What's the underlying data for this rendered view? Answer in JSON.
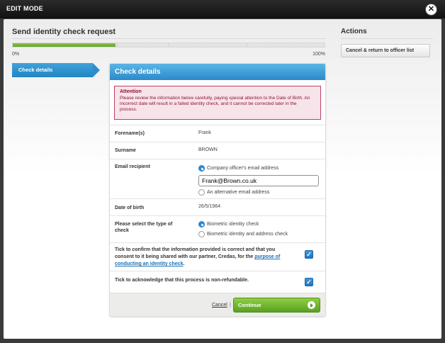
{
  "window": {
    "title": "EDIT MODE",
    "close_symbol": "✕"
  },
  "page": {
    "heading": "Send identity check request"
  },
  "progress": {
    "min_label": "0%",
    "max_label": "100%",
    "value_fraction": 0.33
  },
  "steps": [
    {
      "label": "Check details",
      "active": true
    }
  ],
  "card": {
    "title": "Check details",
    "attention": {
      "title": "Attention",
      "text": "Please review the information below carefully, paying special attention to the Date of Birth. An incorrect date will result in a failed identity check, and it cannot be corrected later in the process."
    },
    "fields": {
      "forename": {
        "label": "Forename(s)",
        "value": "Frank"
      },
      "surname": {
        "label": "Surname",
        "value": "BROWN"
      },
      "email": {
        "label": "Email recipient",
        "option_company": "Company officer's email address",
        "input_value": "Frank@Brown.co.uk",
        "option_alternative": "An alternative email address",
        "selected": "company"
      },
      "dob": {
        "label": "Date of birth",
        "value": "26/5/1964"
      },
      "check_type": {
        "label": "Please select the type of check",
        "option_biometric": "Biometric identity check",
        "option_biometric_address": "Biometric identity and address check",
        "selected": "biometric"
      }
    },
    "consent": {
      "text_before": "Tick to confirm that the information provided is correct and that you consent to it being shared with our partner, Credas, for the ",
      "link_text": "purpose of conducting an identity check",
      "text_after": ".",
      "checked": true
    },
    "nonrefundable": {
      "text": "Tick to acknowledge that this process is non-refundable.",
      "checked": true
    },
    "footer": {
      "cancel_label": "Cancel",
      "separator": "|",
      "continue_label": "Continue"
    }
  },
  "actions": {
    "title": "Actions",
    "button_label": "Cancel & return to officer list"
  },
  "colors": {
    "accent_blue": "#2d8ac9",
    "continue_green": "#5aa021",
    "progress_green": "#62a12b",
    "attention_red": "#c14060"
  }
}
